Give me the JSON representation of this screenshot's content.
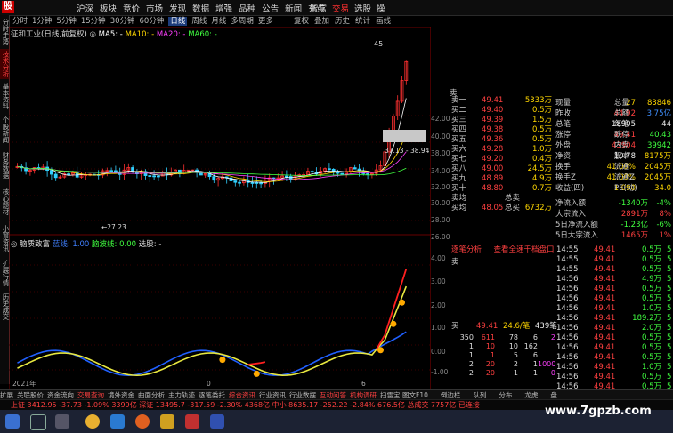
{
  "app": {
    "menu": [
      "沪深",
      "板块",
      "竞价",
      "市场",
      "发现",
      "数据",
      "增强",
      "品种",
      "公告",
      "新闻",
      "充点"
    ],
    "menu_right": [
      "智富",
      "交易",
      "选股",
      "操"
    ],
    "logo": "股"
  },
  "periods": [
    "分时",
    "1分钟",
    "5分钟",
    "15分钟",
    "30分钟",
    "60分钟",
    "日线",
    "周线",
    "月线",
    "多周期",
    "更多"
  ],
  "period_selected": "日线",
  "tools": [
    "复权",
    "叠加",
    "历史",
    "统计",
    "画线"
  ],
  "left_tabs": [
    "分时走势",
    "技术分析",
    "基本资料",
    "个股新闻",
    "财务数据",
    "核心题材",
    "小窗资讯",
    "扩展行情",
    "历史成交"
  ],
  "kline": {
    "stock": "征和工业(日线,前复权)",
    "ma5": "MA5: -",
    "ma10": "MA10: -",
    "ma20": "MA20: -",
    "ma60": "MA60: -",
    "high_label": "37.13",
    "low_label": "27.23",
    "dash_label": "38.94",
    "corner_label": "45",
    "axis": [
      "42.00",
      "40.00",
      "38.00",
      "36.94",
      "34.00",
      "32.00",
      "30.00",
      "28.00",
      "26.00"
    ]
  },
  "indicator": {
    "name": "脑质致富",
    "line1": "蓝线: 1.00",
    "line2": "脑波线: 0.00",
    "line3": "选股: -",
    "axis": [
      "4.00",
      "3.00",
      "2.00",
      "1.00",
      "0.00",
      "-1.00"
    ],
    "date_left": "2021年",
    "label_x1": "0",
    "label_x2": "6"
  },
  "book": {
    "sell_header": "卖一",
    "buy_header": "买一",
    "rows": [
      {
        "label": "卖一",
        "price": "49.41",
        "vol": "5333万"
      },
      {
        "label": "买二",
        "price": "49.40",
        "vol": "0.5万"
      },
      {
        "label": "买三",
        "price": "49.39",
        "vol": "1.5万"
      },
      {
        "label": "买四",
        "price": "49.38",
        "vol": "0.5万"
      },
      {
        "label": "买五",
        "price": "49.36",
        "vol": "0.5万"
      },
      {
        "label": "买六",
        "price": "49.28",
        "vol": "1.0万"
      },
      {
        "label": "买七",
        "price": "49.20",
        "vol": "0.4万"
      },
      {
        "label": "买八",
        "price": "49.00",
        "vol": "24.5万"
      },
      {
        "label": "买九",
        "price": "48.89",
        "vol": "4.9万"
      },
      {
        "label": "买十",
        "price": "48.80",
        "vol": "0.7万"
      }
    ],
    "row_a": {
      "k1": "卖均",
      "v1": "",
      "k2": "总卖",
      "v2": ""
    },
    "row_b": {
      "k1": "买均",
      "v1": "48.05",
      "k2": "总买",
      "v2": "6732万"
    },
    "actions": [
      "逐笔分析",
      "查看全速千档盘口"
    ]
  },
  "quote": {
    "rows": [
      {
        "k1": "现量",
        "v1": "27",
        "k2": "总量",
        "v2": "83846"
      },
      {
        "k1": "昨收",
        "v1": "44.92",
        "k2": "总额",
        "v2": "3.75亿"
      },
      {
        "k1": "总笔",
        "v1": "18905",
        "k2": "每笔",
        "v2": "44"
      },
      {
        "k1": "涨停",
        "v1": "49.41",
        "k2": "跌停",
        "v2": "40.43"
      },
      {
        "k1": "外盘",
        "v1": "43904",
        "k2": "内盘",
        "v2": "39942"
      },
      {
        "k1": "净资",
        "v1": "10.78",
        "k2": "股本",
        "v2": "8175万"
      },
      {
        "k1": "换手",
        "v1": "41.00%",
        "k2": "流通",
        "v2": "2045万"
      },
      {
        "k1": "换手Z",
        "v1": "41.00%",
        "k2": "流通Z",
        "v2": "2045万"
      },
      {
        "k1": "收益(四)",
        "v1": "1.090",
        "k2": "PE(动)",
        "v2": "34.0"
      }
    ],
    "flow": [
      {
        "k": "净流入额",
        "v": "-1340万",
        "pct": "-4%"
      },
      {
        "k": "大宗流入",
        "v": "2891万",
        "pct": "8%"
      },
      {
        "k": "5日净流入额",
        "v": "-1.23亿",
        "pct": "-6%"
      },
      {
        "k": "5日大宗流入",
        "v": "1465万",
        "pct": "1%"
      }
    ]
  },
  "ticks": [
    {
      "t": "14:55",
      "p": "49.41",
      "v": "0.5万",
      "a": "5",
      "r": false
    },
    {
      "t": "14:55",
      "p": "49.41",
      "v": "0.5万",
      "a": "5",
      "r": false
    },
    {
      "t": "14:55",
      "p": "49.41",
      "v": "0.5万",
      "a": "5",
      "r": false
    },
    {
      "t": "14:56",
      "p": "49.41",
      "v": "4.9万",
      "a": "5",
      "r": false
    },
    {
      "t": "14:56",
      "p": "49.41",
      "v": "0.5万",
      "a": "5",
      "r": false
    },
    {
      "t": "14:56",
      "p": "49.41",
      "v": "0.5万",
      "a": "5",
      "r": false
    },
    {
      "t": "14:56",
      "p": "49.41",
      "v": "1.0万",
      "a": "5",
      "r": false
    },
    {
      "t": "14:56",
      "p": "49.41",
      "v": "189.2万",
      "a": "5",
      "r": false
    },
    {
      "t": "14:56",
      "p": "49.41",
      "v": "2.0万",
      "a": "5",
      "r": false
    },
    {
      "t": "14:56",
      "p": "49.41",
      "v": "0.5万",
      "a": "5",
      "r": false
    },
    {
      "t": "14:56",
      "p": "49.41",
      "v": "0.5万",
      "a": "5",
      "r": false
    },
    {
      "t": "14:56",
      "p": "49.41",
      "v": "0.5万",
      "a": "5",
      "r": false
    },
    {
      "t": "14:56",
      "p": "49.41",
      "v": "1.0万",
      "a": "5",
      "r": false
    },
    {
      "t": "14:56",
      "p": "49.41",
      "v": "0.5万",
      "a": "5",
      "r": false
    },
    {
      "t": "14:56",
      "p": "49.41",
      "v": "0.5万",
      "a": "5",
      "r": false
    }
  ],
  "depth": {
    "title": "卖一",
    "buy1": {
      "label": "买一",
      "p": "49.41",
      "v": "24.6/笔",
      "n": "439笔"
    },
    "grid": [
      [
        "350",
        "611",
        "78",
        "6",
        "2"
      ],
      [
        "1",
        "10",
        "10",
        "162",
        ""
      ],
      [
        "1",
        "1",
        "5",
        "6",
        ""
      ],
      [
        "2",
        "20",
        "2",
        "1",
        "1000"
      ],
      [
        "2",
        "20",
        "1",
        "1",
        "0"
      ]
    ]
  },
  "bottom_right_tabs": [
    "笔",
    "价",
    "细",
    "分",
    "盘",
    "明",
    "筹"
  ],
  "bottom_tabs": [
    "扩展",
    "关联股价",
    "资金流向",
    "交易查询",
    "境外资金",
    "曲面分析",
    "主力轨迹",
    "逐笔委托",
    "综合资讯",
    "行业资讯",
    "行业数据",
    "互动问答",
    "机构调研",
    "扫雷宝"
  ],
  "bottom_tabs_active": [
    "交易查询",
    "综合资讯",
    "互动问答",
    "机构调研"
  ],
  "right_tabs2": [
    "图文F10",
    "倒边栏",
    "队列",
    "分布",
    "龙虎",
    "盘"
  ],
  "index_bar": "上证 3412.95 -37.73 -1.09% 3399亿   深证 13495.7 -317.59 -2.30% 4368亿   中小 8635.17 -252.22 -2.84% 676.5亿   总成交 7757亿   已连接",
  "watermark": "www.7gpzb.com",
  "colors": {
    "up": "#ff4040",
    "down": "#40ff40",
    "accent": "#ffd700"
  }
}
